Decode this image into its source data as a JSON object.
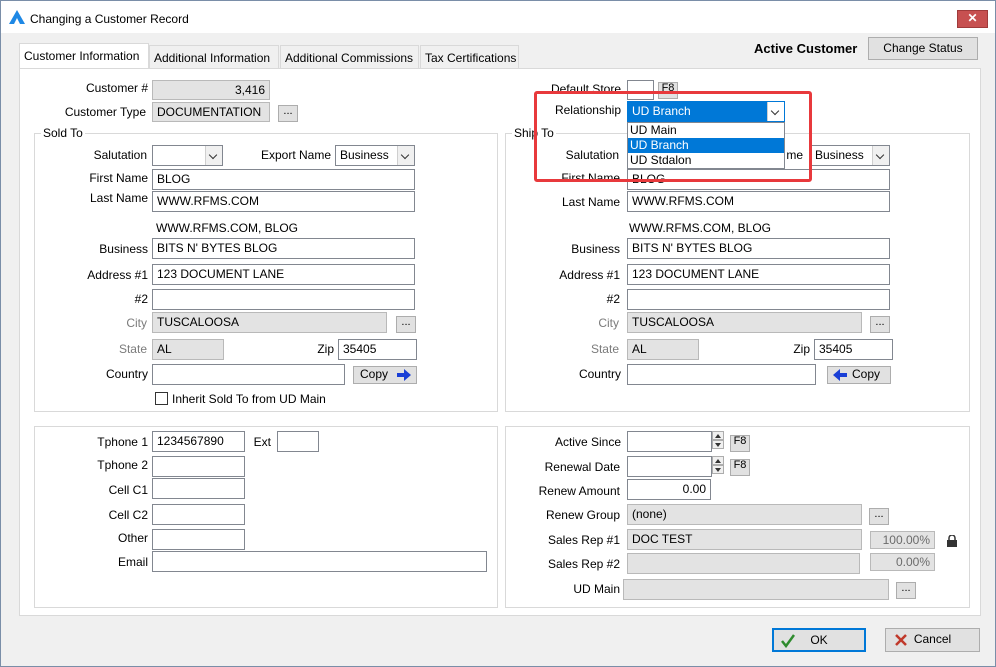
{
  "window": {
    "title": "Changing a Customer Record",
    "close_label": "✕"
  },
  "header": {
    "status_text": "Active Customer",
    "change_status_label": "Change Status"
  },
  "tabs": [
    {
      "label": "Customer Information"
    },
    {
      "label": "Additional Information"
    },
    {
      "label": "Additional Commissions"
    },
    {
      "label": "Tax Certifications"
    }
  ],
  "top": {
    "customer_num_label": "Customer #",
    "customer_num_value": "3,416",
    "customer_type_label": "Customer Type",
    "customer_type_value": "DOCUMENTATION",
    "ellipsis": "...",
    "default_store_label": "Default Store",
    "default_store_value": "",
    "f8": "F8",
    "relationship_label": "Relationship",
    "relationship_value": "UD Branch",
    "relationship_options": [
      "UD Main",
      "UD Branch",
      "UD Stdalon"
    ]
  },
  "sold_to": {
    "title": "Sold To",
    "salutation_label": "Salutation",
    "salutation_value": "",
    "export_name_label": "Export Name",
    "export_name_value": "Business",
    "first_name_label": "First Name",
    "first_name_value": "BLOG",
    "last_name_label": "Last Name",
    "last_name_value": "WWW.RFMS.COM",
    "display_name": "WWW.RFMS.COM, BLOG",
    "business_label": "Business",
    "business_value": "BITS N' BYTES BLOG",
    "address1_label": "Address #1",
    "address1_value": "123 DOCUMENT LANE",
    "address2_label": "#2",
    "address2_value": "",
    "city_label": "City",
    "city_value": "TUSCALOOSA",
    "state_label": "State",
    "state_value": "AL",
    "zip_label": "Zip",
    "zip_value": "35405",
    "country_label": "Country",
    "country_value": "",
    "copy_label": "Copy",
    "inherit_label": "Inherit Sold To from UD Main",
    "inherit_checked": false
  },
  "ship_to": {
    "title": "Ship To",
    "salutation_label": "Salutation",
    "name_label_partial": "me",
    "name_value": "Business",
    "first_name_label": "First Name",
    "first_name_value": "BLOG",
    "last_name_label": "Last Name",
    "last_name_value": "WWW.RFMS.COM",
    "display_name": "WWW.RFMS.COM, BLOG",
    "business_label": "Business",
    "business_value": "BITS N' BYTES BLOG",
    "address1_label": "Address #1",
    "address1_value": "123 DOCUMENT LANE",
    "address2_label": "#2",
    "address2_value": "",
    "city_label": "City",
    "city_value": "TUSCALOOSA",
    "state_label": "State",
    "state_value": "AL",
    "zip_label": "Zip",
    "zip_value": "35405",
    "country_label": "Country",
    "country_value": "",
    "copy_label": "Copy"
  },
  "contact": {
    "tphone1_label": "Tphone 1",
    "tphone1_value": "1234567890",
    "ext_label": "Ext",
    "ext_value": "",
    "tphone2_label": "Tphone 2",
    "cell1_label": "Cell C1",
    "cell2_label": "Cell C2",
    "other_label": "Other",
    "email_label": "Email"
  },
  "account": {
    "active_since_label": "Active Since",
    "renewal_date_label": "Renewal Date",
    "renew_amount_label": "Renew Amount",
    "renew_amount_value": "0.00",
    "renew_group_label": "Renew Group",
    "renew_group_value": "(none)",
    "sales_rep1_label": "Sales Rep #1",
    "sales_rep1_value": "DOC TEST",
    "sales_rep1_pct": "100.00%",
    "sales_rep2_label": "Sales Rep #2",
    "sales_rep2_value": "",
    "sales_rep2_pct": "0.00%",
    "ud_main_label": "UD Main",
    "ud_main_value": ""
  },
  "footer": {
    "ok_label": "OK",
    "cancel_label": "Cancel"
  },
  "colors": {
    "highlight": "#e8393c",
    "selection": "#0078d7",
    "accent_arrow": "#1a3fd6"
  }
}
